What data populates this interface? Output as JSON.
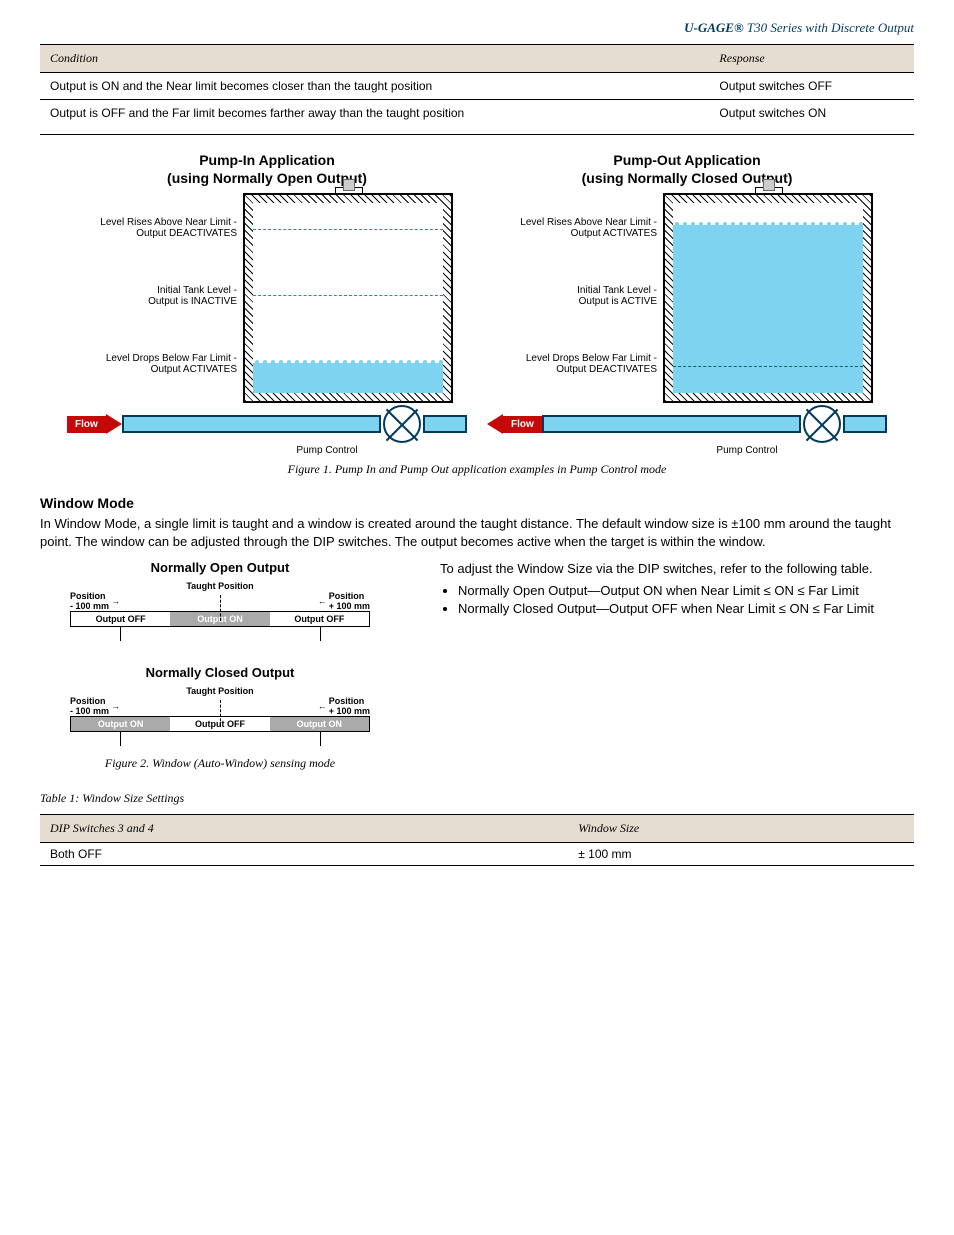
{
  "brand": "U-GAGE®",
  "model_line": "T30 Series with Discrete Output",
  "table_pump": {
    "headers": [
      "Condition",
      "Response"
    ],
    "rows": [
      [
        "Output is ON and the Near limit becomes closer than the taught position",
        "Output switches OFF"
      ],
      [
        "Output is OFF and the Far limit becomes farther away than the taught position",
        "Output switches ON"
      ]
    ]
  },
  "fig1": {
    "title1": "Pump-In Application",
    "title1b": "(using Normally Open Output)",
    "title2": "Pump-Out Application",
    "title2b": "(using Normally Closed Output)",
    "l_near": "Level Rises Above Near Limit -\nOutput DEACTIVATES",
    "l_init": "Initial Tank Level -\nOutput is INACTIVE",
    "l_far": "Level Drops Below Far Limit -\nOutput ACTIVATES",
    "r_near": "Level Rises Above Near Limit -\nOutput ACTIVATES",
    "r_init": "Initial Tank Level -\nOutput is ACTIVE",
    "r_far": "Level Drops Below Far Limit -\nOutput DEACTIVATES",
    "flow": "Flow",
    "pump": "Pump Control",
    "caption": "Figure 1. Pump In and Pump Out application examples in Pump Control mode"
  },
  "section_windowmode_title": "Window Mode",
  "section_windowmode_text": "In Window Mode, a single limit is taught and a window is created around the taught distance. The default window size is ±100 mm around the taught point. The window can be adjusted through the DIP switches. The output becomes active when the target is within the window.",
  "fig2": {
    "no_title": "Normally Open Output",
    "nc_title": "Normally Closed Output",
    "taught": "Taught Position",
    "pos_minus": "Position\n- 100 mm",
    "pos_plus": "Position\n+ 100 mm",
    "on": "Output ON",
    "off": "Output OFF",
    "caption": "Figure 2. Window (Auto-Window) sensing mode",
    "right_text_intro": "To adjust the Window Size via the DIP switches, refer to the following table.",
    "formula": "Near Limit ≤ ON ≤ Far Limit",
    "bullets": [
      "Normally Open Output—Output ON when",
      "Normally Closed Output—Output OFF when"
    ]
  },
  "table_window": {
    "title": "Table 1: Window Size Settings",
    "headers": [
      "DIP Switches 3 and 4",
      "Window Size"
    ],
    "rows": [
      [
        "Both OFF",
        "± 100 mm"
      ]
    ]
  },
  "chart_data": [
    {
      "type": "bar",
      "title": "Normally Open Output",
      "categories": [
        "Position - 100 mm",
        "Taught Position window",
        "Position + 100 mm"
      ],
      "series": [
        {
          "name": "Output",
          "values": [
            "OFF",
            "ON",
            "OFF"
          ]
        }
      ]
    },
    {
      "type": "bar",
      "title": "Normally Closed Output",
      "categories": [
        "Position - 100 mm",
        "Taught Position window",
        "Position + 100 mm"
      ],
      "series": [
        {
          "name": "Output",
          "values": [
            "ON",
            "OFF",
            "ON"
          ]
        }
      ]
    }
  ]
}
